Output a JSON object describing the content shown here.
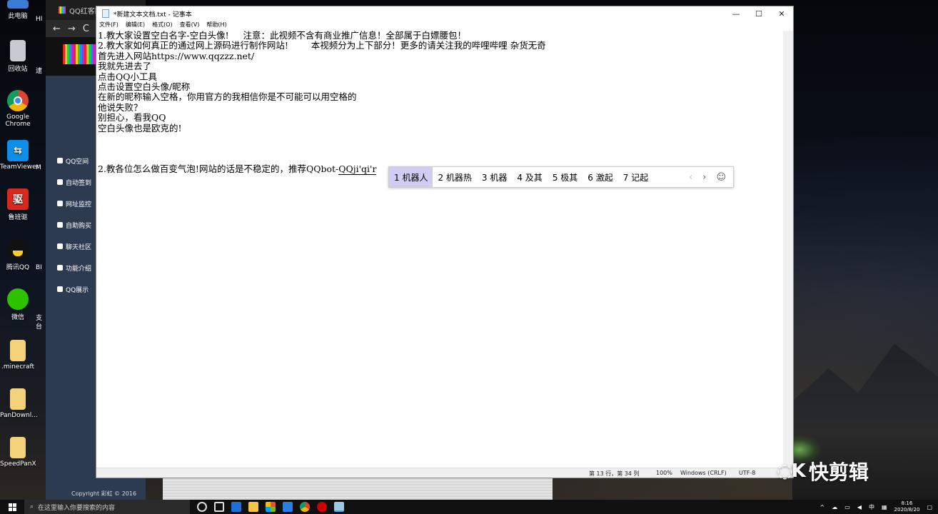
{
  "desktop": {
    "icons": [
      {
        "label": "此电脑",
        "icon": "computer-icon"
      },
      {
        "label": "回收站",
        "icon": "recycle-bin-icon"
      },
      {
        "label": "Google Chrome",
        "icon": "chrome-icon"
      },
      {
        "label": "TeamViewer",
        "icon": "teamviewer-icon"
      },
      {
        "label": "鲁班驱",
        "icon": "driver-icon"
      },
      {
        "label": "腾讯QQ",
        "icon": "qq-icon"
      },
      {
        "label": "微信",
        "icon": "wechat-icon"
      },
      {
        "label": ".minecraft",
        "icon": "folder-icon"
      },
      {
        "label": "PanDownl...",
        "icon": "folder-icon"
      },
      {
        "label": "SpeedPanX",
        "icon": "folder-icon"
      }
    ],
    "partial_labels": [
      "HI",
      "逮",
      "M",
      "BI",
      "支",
      "台"
    ],
    "glyphs": {
      "red_icon": "驱"
    }
  },
  "browser": {
    "tab_title": "QQ红客网",
    "nav": {
      "back": "←",
      "forward": "→",
      "refresh": "C"
    },
    "side_menu": [
      "QQ空间",
      "自动签到",
      "网址监控",
      "自助购买",
      "聊天社区",
      "功能介绍",
      "QQ展示"
    ],
    "copyright": "Copyright 彩虹 © 2016"
  },
  "notepad": {
    "title": "*新建文本文档.txt - 记事本",
    "controls": {
      "minimize": "—",
      "maximize": "☐",
      "close": "✕"
    },
    "menu": [
      "文件(F)",
      "编辑(E)",
      "格式(O)",
      "查看(V)",
      "帮助(H)"
    ],
    "lines": [
      "1.教大家设置空白名字-空白头像!     注意：此视频不含有商业推广信息！全部属于白嫖腰包！",
      "2.教大家如何真正的通过网上源码进行制作网站!        本视频分为上下部分！更多的请关注我的哔哩哔哩 杂货无奇",
      "首先进入网站https://www.qqzzz.net/",
      "我就先进去了",
      "点击QQ小工具",
      "点击设置空白头像/昵称",
      "在新的昵称输入空格，你用官方的我相信你是不可能可以用空格的",
      "他说失败？",
      "别担心，看我QQ",
      "空白头像也是欧克的!",
      "",
      "",
      ""
    ],
    "last_line_prefix": "2.教各位怎么做百变气泡!网站的话是不稳定的，推荐QQbot-",
    "composing_text": "QQji'qi'r",
    "status": {
      "position": "第 13 行，第 34 列",
      "zoom": "100%",
      "line_ending": "Windows (CRLF)",
      "encoding": "UTF-8"
    }
  },
  "ime": {
    "candidates": [
      "1 机器人",
      "2 机器热",
      "3 机器",
      "4 及其",
      "5 极其",
      "6 激起",
      "7 记起"
    ],
    "selected_index": 0,
    "prev": "‹",
    "next": "›",
    "emoji": "☺"
  },
  "watermark": {
    "logo": "◌K",
    "text": "快剪辑"
  },
  "taskbar": {
    "search_placeholder": "在这里输入你要搜索的内容",
    "time": "8:16",
    "date": "2020/8/20",
    "ime_indicator": "中"
  }
}
